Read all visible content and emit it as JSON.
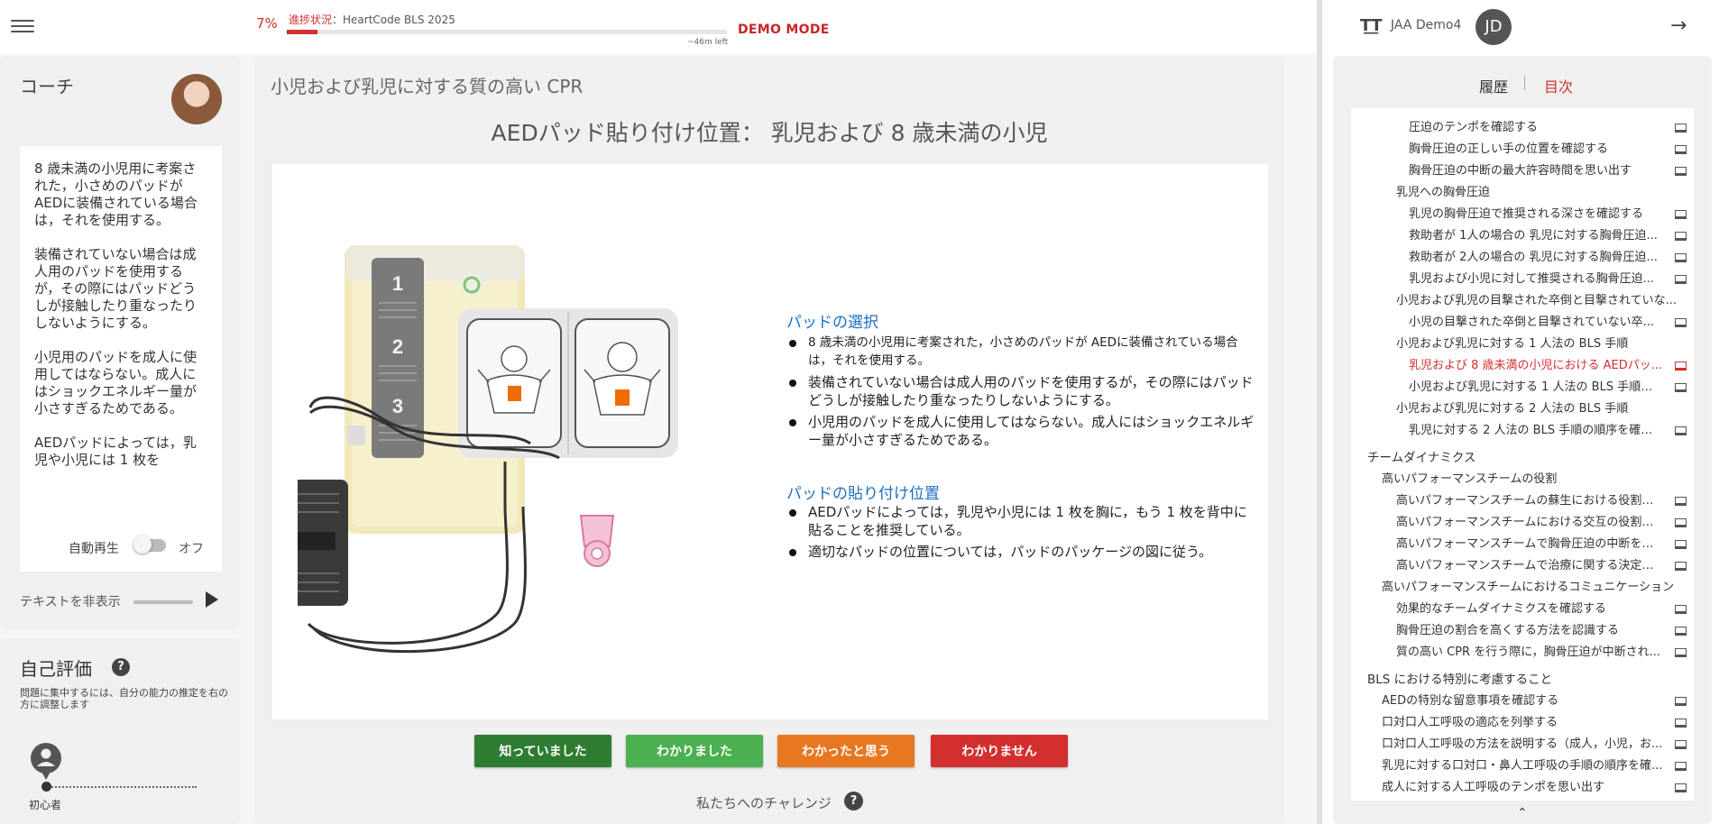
{
  "header": {
    "progress_percent": "7%",
    "progress_value": 0.07,
    "progress_label_prefix": "進捗状況",
    "progress_label_course": "：HeartCode BLS 2025",
    "time_left": "~46m left",
    "demo_mode": "DEMO MODE"
  },
  "coach": {
    "title": "コーチ",
    "paragraphs": [
      "8 歳未満の小児用に考案された，小さめのパッドがAEDに装備されている場合は，それを使用する。",
      "装備されていない場合は成人用のパッドを使用するが，その際にはパッドどうしが接触したり重なったりしないようにする。",
      "小児用のパッドを成人に使用してはならない。成人にはショックエネルギー量が小さすぎるためである。",
      "AEDパッドによっては，乳児や小児には 1 枚を"
    ],
    "autoplay_label": "自動再生",
    "autoplay_state": "オフ",
    "hide_text_label": "テキストを非表示"
  },
  "self_assessment": {
    "title": "自己評価",
    "help_icon": "?",
    "description": "問題に集中するには、自分の能力の推定を右の方に調整します",
    "level": "初心者"
  },
  "main": {
    "course_title": "小児および乳児に対する質の高い CPR",
    "slide_title": "AEDパッド貼り付け位置： 乳児および 8 歳未満の小児",
    "section1_title": "パッドの選択",
    "section1_bullets": [
      "8 歳未満の小児用に考案された，小さめのパッドが AEDに装備されている場合は，それを使用する。",
      "装備されていない場合は成人用のパッドを使用するが，その際にはパッドどうしが接触したり重なったりしないようにする。",
      "小児用のパッドを成人に使用してはならない。成人にはショックエネルギー量が小さすぎるためである。"
    ],
    "section2_title": "パッドの貼り付け位置",
    "section2_bullets": [
      "AEDパッドによっては，乳児や小児には 1 枚を胸に，もう 1 枚を背中に貼ることを推奨している。",
      "適切なパッドの位置については，パッドのパッケージの図に従う。"
    ],
    "illustration": {
      "step_numbers": [
        "1",
        "2",
        "3"
      ]
    },
    "buttons": {
      "knew": "知っていました",
      "got_it": "わかりました",
      "think_so": "わかったと思う",
      "dont_know": "わかりません"
    },
    "challenge_label": "私たちへのチャレンジ",
    "challenge_help": "?"
  },
  "right_panel": {
    "font_icon": "T͟T",
    "user_name": "JAA Demo4",
    "user_initials": "JD",
    "exit_icon": "→",
    "tab_history": "履歴",
    "tab_toc": "目次",
    "scroll_up_icon": "⌃",
    "toc_items": [
      {
        "text": "圧迫のテンポを確認する",
        "level": 3,
        "check": true
      },
      {
        "text": "胸骨圧迫の正しい手の位置を確認する",
        "level": 3,
        "check": true
      },
      {
        "text": "胸骨圧迫の中断の最大許容時間を思い出す",
        "level": 3,
        "check": true
      },
      {
        "text": "乳児への胸骨圧迫",
        "level": 2,
        "check": false
      },
      {
        "text": "乳児の胸骨圧迫で推奨される深さを確認する",
        "level": 3,
        "check": true
      },
      {
        "text": "救助者が 1人の場合の 乳児に対する胸骨圧迫...",
        "level": 3,
        "check": true
      },
      {
        "text": "救助者が 2人の場合の 乳児に対する胸骨圧迫...",
        "level": 3,
        "check": true
      },
      {
        "text": "乳児および小児に対して推奨される胸骨圧迫...",
        "level": 3,
        "check": true
      },
      {
        "text": "小児および乳児の目撃された卒倒と目撃されていな...",
        "level": 2,
        "check": false
      },
      {
        "text": "小児の目撃された卒倒と目撃されていない卒...",
        "level": 3,
        "check": true
      },
      {
        "text": "小児および乳児に対する 1 人法の BLS 手順",
        "level": 2,
        "check": false
      },
      {
        "text": "乳児および 8 歳未満の小児における AEDパッ...",
        "level": 3,
        "check": true,
        "active": true
      },
      {
        "text": "小児および乳児に対する 1 人法の BLS 手順に...",
        "level": 3,
        "check": true
      },
      {
        "text": "小児および乳児に対する 2 人法の BLS 手順",
        "level": 2,
        "check": false
      },
      {
        "text": "乳児に対する 2 人法の BLS 手順の順序を確認...",
        "level": 3,
        "check": true
      },
      {
        "text": "チームダイナミクス",
        "level": 0,
        "check": false
      },
      {
        "text": "高いパフォーマンスチームの役割",
        "level": 1,
        "check": false
      },
      {
        "text": "高いパフォーマンスチームの蘇生における役割の...",
        "level": 2,
        "check": true
      },
      {
        "text": "高いパフォーマンスチームにおける交互の役割を...",
        "level": 2,
        "check": true
      },
      {
        "text": "高いパフォーマンスチームで胸骨圧迫の中断を記...",
        "level": 2,
        "check": true
      },
      {
        "text": "高いパフォーマンスチームで治療に関する決定を...",
        "level": 2,
        "check": true
      },
      {
        "text": "高いパフォーマンスチームにおけるコミュニケーション",
        "level": 1,
        "check": false
      },
      {
        "text": "効果的なチームダイナミクスを確認する",
        "level": 2,
        "check": true
      },
      {
        "text": "胸骨圧迫の割合を高くする方法を認識する",
        "level": 2,
        "check": true
      },
      {
        "text": "質の高い CPR を行う際に，胸骨圧迫が中断され...",
        "level": 2,
        "check": true
      },
      {
        "text": "BLS における特別に考慮すること",
        "level": 0,
        "check": false
      },
      {
        "text": "AEDの特別な留意事項を確認する",
        "level": 1,
        "check": true
      },
      {
        "text": "口対口人工呼吸の適応を列挙する",
        "level": 1,
        "check": true
      },
      {
        "text": "口対口人工呼吸の方法を説明する（成人，小児，お...",
        "level": 1,
        "check": true
      },
      {
        "text": "乳児に対する口対口・鼻人工呼吸の手順の順序を確...",
        "level": 1,
        "check": true
      },
      {
        "text": "成人に対する人工呼吸のテンポを思い出す",
        "level": 1,
        "check": true
      }
    ]
  },
  "colors": {
    "accent_red": "#d32f2f",
    "link_blue": "#1e6fbf",
    "btn_knew": "#2e7d32",
    "btn_got": "#4caf50",
    "btn_think": "#e87722",
    "btn_dont": "#d32f2f"
  }
}
